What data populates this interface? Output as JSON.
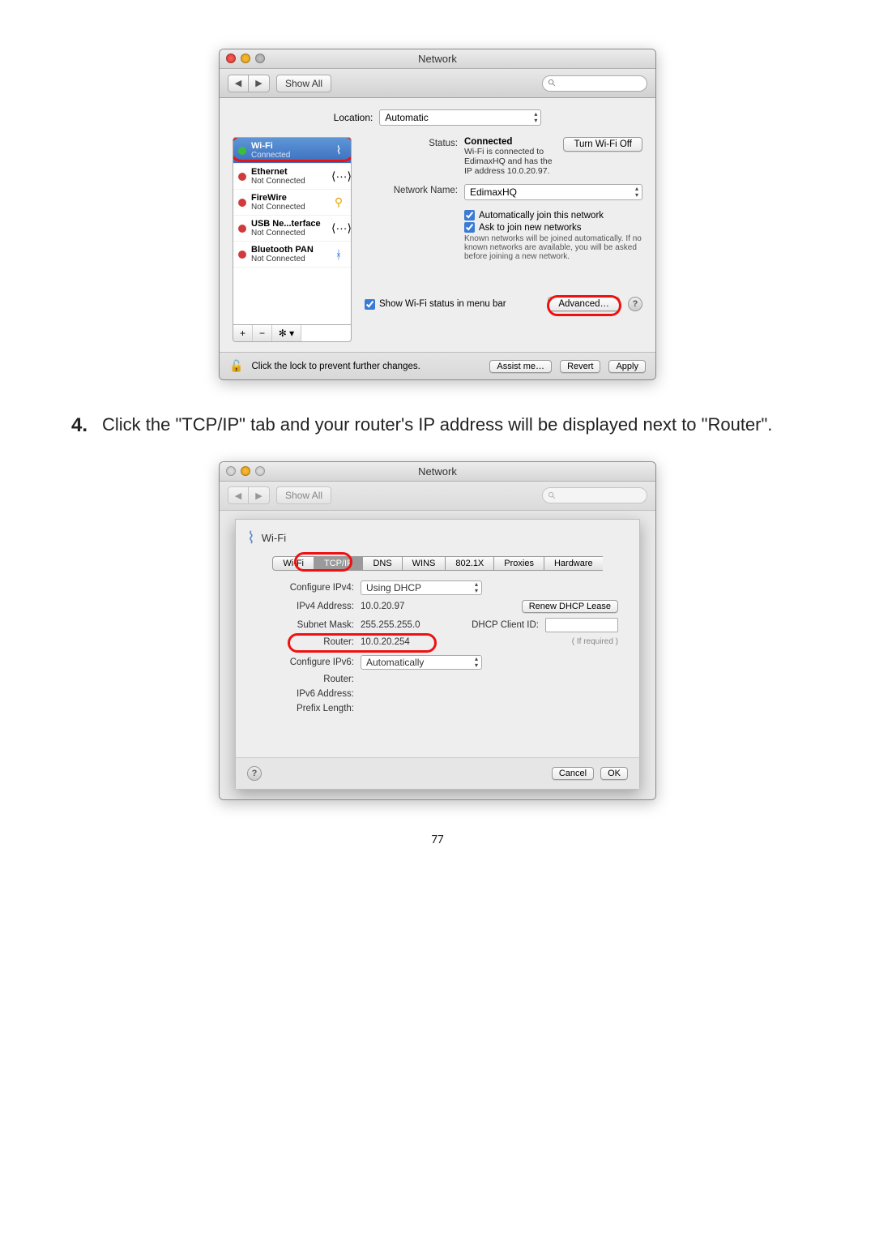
{
  "window1": {
    "title": "Network",
    "toolbar": {
      "show_all": "Show All"
    },
    "location_label": "Location:",
    "location_value": "Automatic",
    "interfaces": [
      {
        "name": "Wi-Fi",
        "status": "Connected",
        "dot": "green"
      },
      {
        "name": "Ethernet",
        "status": "Not Connected",
        "dot": "red"
      },
      {
        "name": "FireWire",
        "status": "Not Connected",
        "dot": "red"
      },
      {
        "name": "USB Ne...terface",
        "status": "Not Connected",
        "dot": "red"
      },
      {
        "name": "Bluetooth PAN",
        "status": "Not Connected",
        "dot": "red"
      }
    ],
    "status_label": "Status:",
    "status_value": "Connected",
    "turn_off": "Turn Wi-Fi Off",
    "status_sub": "Wi-Fi is connected to EdimaxHQ and has the IP address 10.0.20.97.",
    "network_name_label": "Network Name:",
    "network_name_value": "EdimaxHQ",
    "auto_join": "Automatically join this network",
    "ask_new": "Ask to join new networks",
    "ask_note": "Known networks will be joined automatically. If no known networks are available, you will be asked before joining a new network.",
    "show_status": "Show Wi-Fi status in menu bar",
    "advanced": "Advanced…",
    "lock_text": "Click the lock to prevent further changes.",
    "assist": "Assist me…",
    "revert": "Revert",
    "apply": "Apply",
    "list_btn_add": "+",
    "list_btn_remove": "−",
    "list_btn_gear": "✻ ▾"
  },
  "instruction": {
    "number": "4.",
    "text": "Click the \"TCP/IP\" tab and your router's IP address will be displayed next to \"Router\"."
  },
  "window2": {
    "title": "Network",
    "toolbar": {
      "show_all": "Show All"
    },
    "sheet_title": "Wi-Fi",
    "tabs": [
      "Wi-Fi",
      "TCP/IP",
      "DNS",
      "WINS",
      "802.1X",
      "Proxies",
      "Hardware"
    ],
    "active_tab": "TCP/IP",
    "configure_ipv4_label": "Configure IPv4:",
    "configure_ipv4_value": "Using DHCP",
    "ipv4_address_label": "IPv4 Address:",
    "ipv4_address_value": "10.0.20.97",
    "subnet_mask_label": "Subnet Mask:",
    "subnet_mask_value": "255.255.255.0",
    "router_label": "Router:",
    "router_value": "10.0.20.254",
    "renew_lease": "Renew DHCP Lease",
    "dhcp_client_id_label": "DHCP Client ID:",
    "dhcp_client_id_note": "( If required )",
    "configure_ipv6_label": "Configure IPv6:",
    "configure_ipv6_value": "Automatically",
    "router6_label": "Router:",
    "ipv6_address_label": "IPv6 Address:",
    "prefix_length_label": "Prefix Length:",
    "cancel": "Cancel",
    "ok": "OK"
  },
  "page_number": "77"
}
